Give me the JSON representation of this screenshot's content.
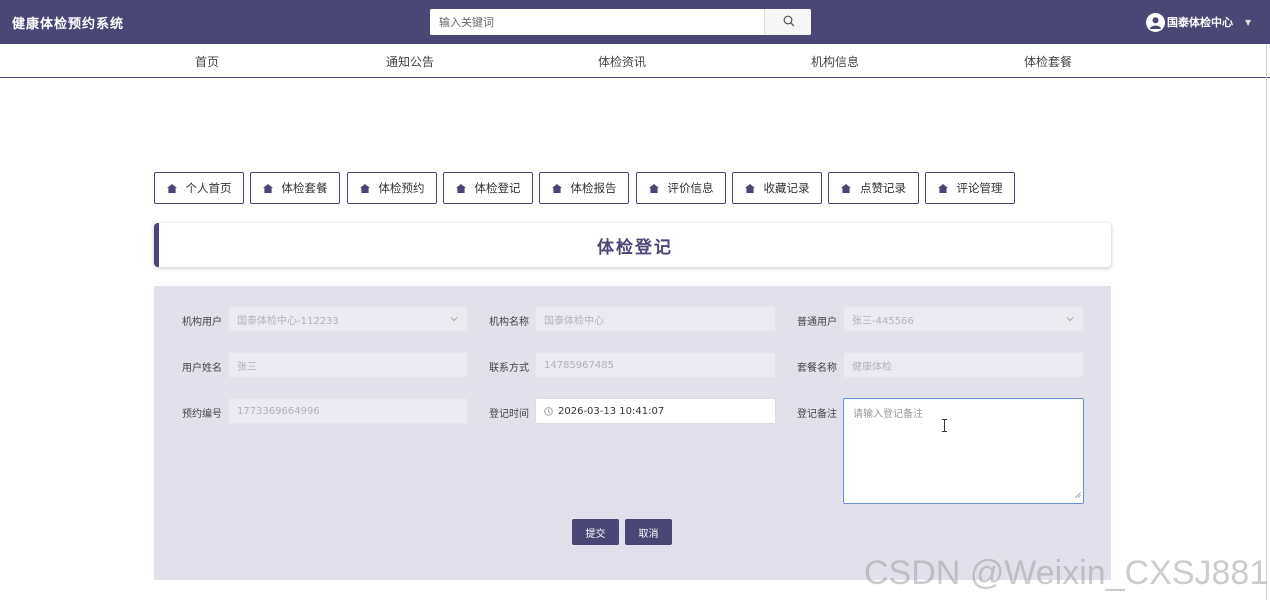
{
  "app": {
    "title": "健康体检预约系统"
  },
  "search": {
    "placeholder": "输入关键词"
  },
  "user": {
    "name": "国泰体检中心"
  },
  "nav": [
    {
      "label": "首页"
    },
    {
      "label": "通知公告"
    },
    {
      "label": "体检资讯"
    },
    {
      "label": "机构信息"
    },
    {
      "label": "体检套餐"
    }
  ],
  "tabs": [
    {
      "label": "个人首页"
    },
    {
      "label": "体检套餐"
    },
    {
      "label": "体检预约"
    },
    {
      "label": "体检登记"
    },
    {
      "label": "体检报告"
    },
    {
      "label": "评价信息"
    },
    {
      "label": "收藏记录"
    },
    {
      "label": "点赞记录"
    },
    {
      "label": "评论管理"
    }
  ],
  "page": {
    "title": "体检登记"
  },
  "form": {
    "org_user": {
      "label": "机构用户",
      "value": "国泰体检中心-112233"
    },
    "org_name": {
      "label": "机构名称",
      "value": "国泰体检中心"
    },
    "normal_user": {
      "label": "普通用户",
      "value": "张三-445566"
    },
    "user_name": {
      "label": "用户姓名",
      "value": "张三"
    },
    "contact": {
      "label": "联系方式",
      "value": "14785967485"
    },
    "package_name": {
      "label": "套餐名称",
      "value": "健康体检"
    },
    "booking_no": {
      "label": "预约编号",
      "value": "1773369664996"
    },
    "register_time": {
      "label": "登记时间",
      "value": "2026-03-13 10:41:07"
    },
    "register_note": {
      "label": "登记备注",
      "placeholder": "请输入登记备注"
    },
    "submit_label": "提交",
    "cancel_label": "取消"
  },
  "watermark": "CSDN @Weixin_CXSJ881",
  "colors": {
    "primary": "#4a4675",
    "panel": "#e2e0ea",
    "field": "#ebeaf0"
  },
  "icons": {
    "search": "search-icon",
    "user": "user-avatar-icon",
    "tab": "house-icon",
    "clock": "clock-icon"
  }
}
